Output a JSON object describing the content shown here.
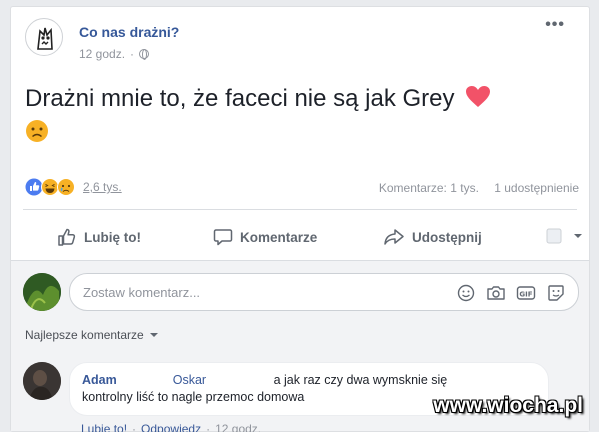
{
  "post": {
    "page_name": "Co nas drażni?",
    "time": "12 godz.",
    "text": "Drażni mnie to, że faceci nie są jak Grey",
    "more_label": "•••"
  },
  "stats": {
    "reactions_count": "2,6 tys.",
    "comments": "Komentarze: 1 tys.",
    "shares": "1 udostępnienie"
  },
  "actions": {
    "like": "Lubię to!",
    "comment": "Komentarze",
    "share": "Udostępnij"
  },
  "comment_box": {
    "placeholder": "Zostaw komentarz..."
  },
  "sort_label": "Najlepsze komentarze",
  "comment": {
    "author": "Adam",
    "tag": "Oskar",
    "text_line1": "a jak raz czy dwa wymsknie się",
    "text_line2": "kontrolny liść to nagle przemoc domowa",
    "like_link": "Lubię to!",
    "reply_link": "Odpowiedz",
    "sep": "·",
    "time": "12 godz."
  },
  "watermark": "www.wiocha.pl",
  "colors": {
    "link_blue": "#365899",
    "gray_text": "#90949c",
    "heart": "#f25268",
    "emoji_yellow": "#f7b125"
  },
  "icons": [
    "globe-icon",
    "heart-icon",
    "sad-emoji-icon",
    "like-icon",
    "haha-icon",
    "comment-icon",
    "share-icon",
    "smiley-icon",
    "camera-icon",
    "gif-icon",
    "sticker-icon",
    "caret-down-icon"
  ]
}
